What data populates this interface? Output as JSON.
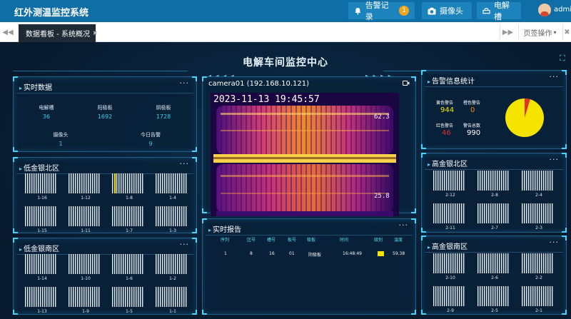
{
  "header": {
    "title": "红外测温监控系统",
    "alarm_button": "告警记录",
    "alarm_count": "1",
    "camera_button": "摄像头",
    "cell_button": "电解槽",
    "username": "admin"
  },
  "tabs": {
    "active_label": "数据看板 - 系统概况",
    "close_glyph": "✖",
    "tab_ops_label": "页签操作",
    "tab_ops_arrow": "▾"
  },
  "dashboard": {
    "title": "电解车间监控中心"
  },
  "realtime_data": {
    "title": "实时数据",
    "more": "···",
    "stats": [
      {
        "label": "电解槽",
        "value": "36"
      },
      {
        "label": "阳极板",
        "value": "1692"
      },
      {
        "label": "阴极板",
        "value": "1728"
      },
      {
        "label": "摄像头",
        "value": "1"
      },
      {
        "label": "今日告警",
        "value": "9"
      }
    ]
  },
  "low_north": {
    "title": "低金银北区",
    "more": "···",
    "cells": [
      "1-16",
      "1-12",
      "1-8",
      "1-4",
      "1-15",
      "1-11",
      "1-7",
      "1-3"
    ]
  },
  "low_south": {
    "title": "低金银南区",
    "more": "···",
    "cells": [
      "1-14",
      "1-10",
      "1-6",
      "1-2",
      "1-13",
      "1-9",
      "1-5",
      "1-1"
    ]
  },
  "high_north": {
    "title": "高金银北区",
    "more": "···",
    "cells": [
      "2-12",
      "2-8",
      "2-4",
      "2-11",
      "2-7",
      "2-3"
    ]
  },
  "high_south": {
    "title": "高金银南区",
    "more": "···",
    "cells": [
      "2-10",
      "2-6",
      "2-2",
      "2-9",
      "2-5",
      "2-1"
    ]
  },
  "camera": {
    "title": "camera01 (192.168.10.121)",
    "timestamp": "2023-11-13 19:45:57",
    "temp_top": "62.3",
    "temp_bottom": "25.8"
  },
  "alarms": {
    "title": "实时报告",
    "more": "···",
    "columns": [
      "序列",
      "区号",
      "槽号",
      "板号",
      "极板",
      "时间",
      "级别",
      "温度"
    ],
    "rows": [
      {
        "seq": "1",
        "area": "8",
        "cell": "16",
        "plate": "01",
        "plate_type": "阴极板",
        "time": "16:48:49",
        "level_color": "#f5e400",
        "temp": "59.38"
      }
    ]
  },
  "alarm_stats": {
    "title": "告警信息统计",
    "more": "···",
    "yellow_label": "黄色警告",
    "yellow_value": "944",
    "orange_label": "橙色警告",
    "orange_value": "0",
    "red_label": "红色警告",
    "red_value": "46",
    "total_label": "警告总数",
    "total_value": "990"
  },
  "colors": {
    "yellow": "#f5e400",
    "orange": "#f08a00",
    "red": "#e0302a",
    "accent": "#45d4ff"
  }
}
